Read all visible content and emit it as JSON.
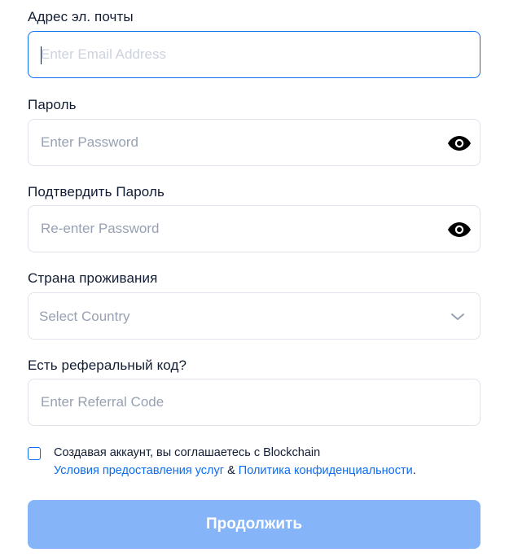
{
  "form": {
    "email": {
      "label": "Адрес эл. почты",
      "placeholder": "Enter Email Address",
      "value": ""
    },
    "password": {
      "label": "Пароль",
      "placeholder": "Enter Password",
      "value": "",
      "toggle_icon": "eye-icon"
    },
    "confirm_password": {
      "label": "Подтвердить Пароль",
      "placeholder": "Re-enter Password",
      "value": "",
      "toggle_icon": "eye-icon"
    },
    "country": {
      "label": "Страна проживания",
      "selected": "Select Country",
      "icon": "chevron-down-icon"
    },
    "referral": {
      "label": "Есть реферальный код?",
      "placeholder": "Enter Referral Code",
      "value": ""
    },
    "terms": {
      "checked": false,
      "text_prefix": "Создавая аккаунт, вы соглашаетесь с Blockchain",
      "terms_link": "Условия предоставления услуг",
      "ampersand": " & ",
      "privacy_link": "Политика конфиденциальности",
      "period": "."
    },
    "submit_label": "Продолжить"
  },
  "colors": {
    "accent": "#0c6cf2",
    "button_disabled": "#85b5f8",
    "border": "#dfe3eb",
    "placeholder": "#98a1b2",
    "text": "#121d33"
  }
}
